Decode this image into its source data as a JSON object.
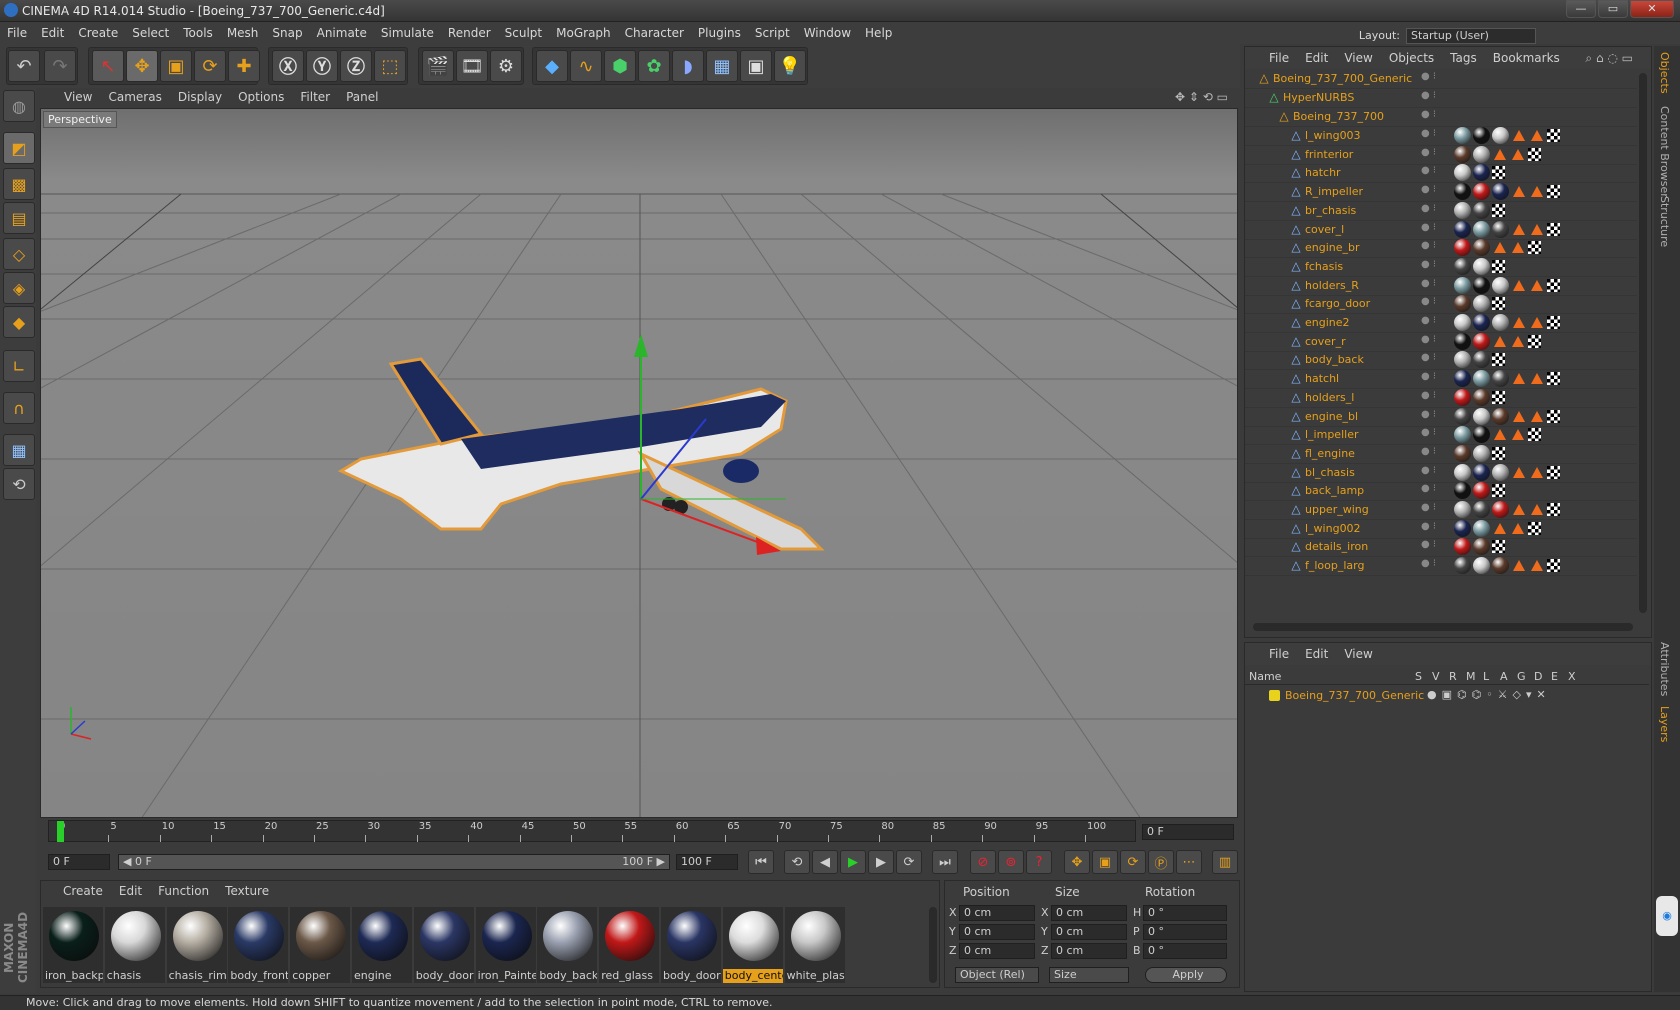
{
  "window": {
    "title": "CINEMA 4D R14.014 Studio - [Boeing_737_700_Generic.c4d]",
    "buttons": [
      "—",
      "▭",
      "✕"
    ]
  },
  "menu": [
    "File",
    "Edit",
    "Create",
    "Select",
    "Tools",
    "Mesh",
    "Snap",
    "Animate",
    "Simulate",
    "Render",
    "Sculpt",
    "MoGraph",
    "Character",
    "Plugins",
    "Script",
    "Window",
    "Help"
  ],
  "layout": {
    "label": "Layout:",
    "value": "Startup (User)"
  },
  "viewport": {
    "menu": [
      "View",
      "Cameras",
      "Display",
      "Options",
      "Filter",
      "Panel"
    ],
    "label": "Perspective"
  },
  "timeline": {
    "ticks": [
      "0",
      "5",
      "10",
      "15",
      "20",
      "25",
      "30",
      "35",
      "40",
      "45",
      "50",
      "55",
      "60",
      "65",
      "70",
      "75",
      "80",
      "85",
      "90",
      "95",
      "100"
    ],
    "current": "0 F"
  },
  "transport": {
    "start": "0 F",
    "range_start": "◀ 0 F",
    "range_end": "100 F ▶",
    "end": "100 F"
  },
  "materials": {
    "menu": [
      "Create",
      "Edit",
      "Function",
      "Texture"
    ],
    "items": [
      {
        "label": "iron_backp",
        "color": "#0a1f1a"
      },
      {
        "label": "chasis",
        "color": "#d8d8d8"
      },
      {
        "label": "chasis_rim",
        "color": "#b5aea3"
      },
      {
        "label": "body_front",
        "color": "#2a3a66"
      },
      {
        "label": "copper",
        "color": "#6b5848"
      },
      {
        "label": "engine",
        "color": "#1e2a55"
      },
      {
        "label": "body_door",
        "color": "#2b3664"
      },
      {
        "label": "iron_Painte",
        "color": "#1b2650"
      },
      {
        "label": "body_back",
        "color": "#9aa0b0"
      },
      {
        "label": "red_glass",
        "color": "#c01818"
      },
      {
        "label": "body_door",
        "color": "#2a3564"
      },
      {
        "label": "body_cente",
        "color": "#dcdcdc"
      },
      {
        "label": "white_plas",
        "color": "#c8c8c8"
      }
    ]
  },
  "coords": {
    "headers": [
      "Position",
      "Size",
      "Rotation"
    ],
    "rows": [
      {
        "pa": "X",
        "pv": "0 cm",
        "sa": "X",
        "sv": "0 cm",
        "ra": "H",
        "rv": "0 °"
      },
      {
        "pa": "Y",
        "pv": "0 cm",
        "sa": "Y",
        "sv": "0 cm",
        "ra": "P",
        "rv": "0 °"
      },
      {
        "pa": "Z",
        "pv": "0 cm",
        "sa": "Z",
        "sv": "0 cm",
        "ra": "B",
        "rv": "0 °"
      }
    ],
    "mode": "Object (Rel)",
    "size_mode": "Size",
    "apply": "Apply"
  },
  "status": "Move: Click and drag to move elements. Hold down SHIFT to quantize movement / add to the selection in point mode, CTRL to remove.",
  "maxon": "MAXON CINEMA4D",
  "objects": {
    "menu": [
      "File",
      "Edit",
      "View",
      "Objects",
      "Tags",
      "Bookmarks"
    ],
    "root": "Boeing_737_700_Generic",
    "nurbs": "HyperNURBS",
    "group": "Boeing_737_700",
    "items": [
      "l_wing003",
      "frinterior",
      "hatchr",
      "R_impeller",
      "br_chasis",
      "cover_l",
      "engine_br",
      "fchasis",
      "holders_R",
      "fcargo_door",
      "engine2",
      "cover_r",
      "body_back",
      "hatchl",
      "holders_l",
      "engine_bl",
      "l_impeller",
      "fl_engine",
      "bl_chasis",
      "back_lamp",
      "upper_wing",
      "l_wing002",
      "details_iron",
      "f_loop_larg"
    ]
  },
  "layers": {
    "menu": [
      "File",
      "Edit",
      "View"
    ],
    "headers": [
      "Name",
      "S",
      "V",
      "R",
      "M",
      "L",
      "A",
      "G",
      "D",
      "E",
      "X"
    ],
    "root": "Boeing_737_700_Generic"
  },
  "sidetabs": [
    "Objects",
    "Content Browser",
    "Structure",
    "Attributes",
    "Layers"
  ]
}
